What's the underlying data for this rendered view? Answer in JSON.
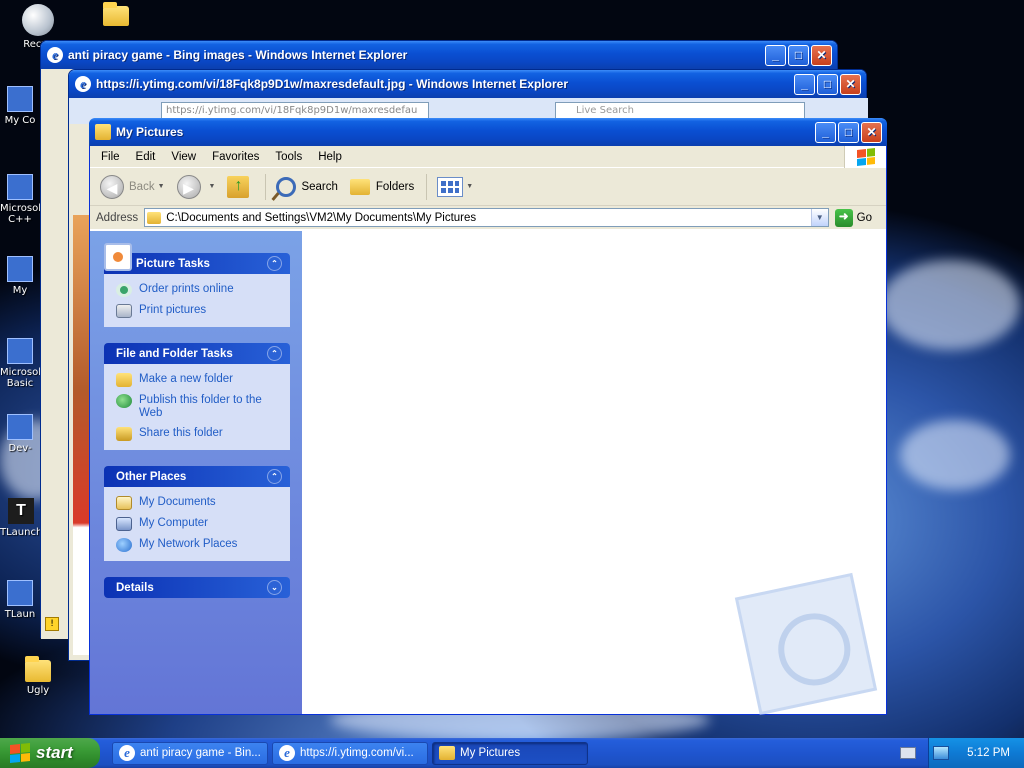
{
  "desktop": {
    "icons": [
      {
        "label": "Recyc",
        "glyph": "recycle"
      },
      {
        "label": "",
        "glyph": "folder"
      },
      {
        "label": "My Co",
        "glyph": "app"
      },
      {
        "label": "Microsol C++",
        "glyph": "app"
      },
      {
        "label": "My",
        "glyph": "app"
      },
      {
        "label": "Microsol Basic",
        "glyph": "app"
      },
      {
        "label": "Dev-",
        "glyph": "app"
      },
      {
        "label": "TLaunch",
        "glyph": "tl"
      },
      {
        "label": "TLaun",
        "glyph": "app"
      },
      {
        "label": "Ugly",
        "glyph": "folder"
      }
    ]
  },
  "ie_back": {
    "title": "anti piracy game - Bing images - Windows Internet Explorer"
  },
  "ie_mid": {
    "title": "https://i.ytimg.com/vi/18Fqk8p9D1w/maxresdefault.jpg - Windows Internet Explorer",
    "url": "https://i.ytimg.com/vi/18Fqk8p9D1w/maxresdefau",
    "search_placeholder": "Live Search"
  },
  "explorer": {
    "title": "My Pictures",
    "menu": [
      "File",
      "Edit",
      "View",
      "Favorites",
      "Tools",
      "Help"
    ],
    "toolbar": {
      "back": "Back",
      "search": "Search",
      "folders": "Folders"
    },
    "address": {
      "label": "Address",
      "path": "C:\\Documents and Settings\\VM2\\My Documents\\My Pictures",
      "go": "Go"
    },
    "tasks": {
      "picture": {
        "title": "Picture Tasks",
        "items": [
          "Order prints online",
          "Print pictures"
        ]
      },
      "file_folder": {
        "title": "File and Folder Tasks",
        "items": [
          "Make a new folder",
          "Publish this folder to the Web",
          "Share this folder"
        ]
      },
      "other": {
        "title": "Other Places",
        "items": [
          "My Documents",
          "My Computer",
          "My Network Places"
        ]
      },
      "details": {
        "title": "Details"
      }
    }
  },
  "taskbar": {
    "start": "start",
    "buttons": [
      {
        "label": "anti piracy game - Bin..."
      },
      {
        "label": "https://i.ytimg.com/vi..."
      },
      {
        "label": "My Pictures"
      }
    ],
    "clock": "5:12 PM"
  },
  "colors": {
    "title_blue": "#0a4fd2",
    "task_pane": "#6f8fe0",
    "start_green": "#3a9b36"
  }
}
